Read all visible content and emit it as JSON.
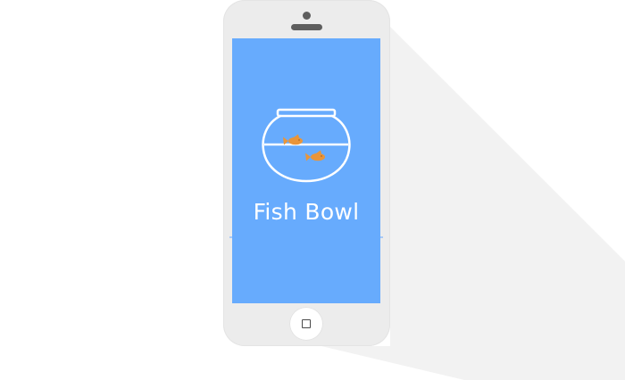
{
  "app": {
    "title": "Fish Bowl"
  },
  "device": {
    "type": "smartphone",
    "body_color": "#ececec",
    "screen_color": "#67abfd",
    "hardware_color": "#5e5e5e"
  },
  "illustration": {
    "name": "fish-bowl",
    "fish_count": 2,
    "fish_color": "#e9953a",
    "bowl_color": "#ffffff"
  },
  "icons": {
    "home": "home-square-icon",
    "camera": "camera-dot-icon",
    "speaker": "speaker-slot-icon"
  }
}
